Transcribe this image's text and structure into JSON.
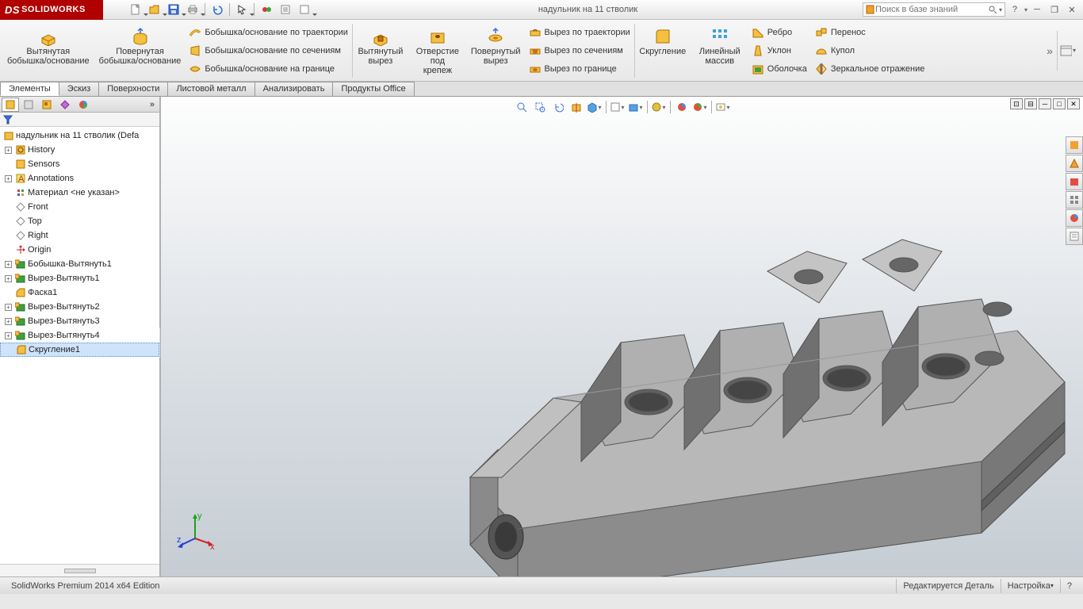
{
  "app": {
    "name": "SOLIDWORKS",
    "ds": "DS"
  },
  "doc_title": "надульник  на 11 стволик",
  "search": {
    "placeholder": "Поиск в базе знаний"
  },
  "ribbon": {
    "extrude_boss": "Вытянутая\nбобышка/основание",
    "revolve_boss": "Повернутая\nбобышка/основание",
    "swept_boss": "Бобышка/основание по траектории",
    "lofted_boss": "Бобышка/основание по сечениям",
    "boundary_boss": "Бобышка/основание на границе",
    "extrude_cut": "Вытянутый\nвырез",
    "hole_wizard": "Отверстие\nпод\nкрепеж",
    "revolve_cut": "Повернутый\nвырез",
    "swept_cut": "Вырез по траектории",
    "lofted_cut": "Вырез по сечениям",
    "boundary_cut": "Вырез по границе",
    "fillet": "Скругление",
    "linpattern": "Линейный\nмассив",
    "rib": "Ребро",
    "draft": "Уклон",
    "shell": "Оболочка",
    "move": "Перенос",
    "dome": "Купол",
    "mirror": "Зеркальное отражение"
  },
  "cmdtabs": [
    "Элементы",
    "Эскиз",
    "Поверхности",
    "Листовой металл",
    "Анализировать",
    "Продукты Office"
  ],
  "tree": {
    "root": "надульник  на 11 стволик  (Defa",
    "items": [
      {
        "exp": "+",
        "icon": "history",
        "label": "History"
      },
      {
        "exp": "",
        "icon": "sensors",
        "label": "Sensors"
      },
      {
        "exp": "+",
        "icon": "annot",
        "label": "Annotations"
      },
      {
        "exp": "",
        "icon": "material",
        "label": "Материал <не указан>"
      },
      {
        "exp": "",
        "icon": "plane",
        "label": "Front"
      },
      {
        "exp": "",
        "icon": "plane",
        "label": "Top"
      },
      {
        "exp": "",
        "icon": "plane",
        "label": "Right"
      },
      {
        "exp": "",
        "icon": "origin",
        "label": "Origin"
      },
      {
        "exp": "+",
        "icon": "feat",
        "label": "Бобышка-Вытянуть1"
      },
      {
        "exp": "+",
        "icon": "feat",
        "label": "Вырез-Вытянуть1"
      },
      {
        "exp": "",
        "icon": "chamf",
        "label": "Фаска1"
      },
      {
        "exp": "+",
        "icon": "feat",
        "label": "Вырез-Вытянуть2"
      },
      {
        "exp": "+",
        "icon": "feat",
        "label": "Вырез-Вытянуть3"
      },
      {
        "exp": "+",
        "icon": "feat",
        "label": "Вырез-Вытянуть4"
      },
      {
        "exp": "",
        "icon": "fillet",
        "label": "Скругление1",
        "sel": true
      }
    ]
  },
  "status": {
    "left": "SolidWorks Premium 2014 x64 Edition",
    "mode": "Редактируется Деталь",
    "custom": "Настройка"
  },
  "triad": {
    "x": "x",
    "y": "y",
    "z": "z"
  }
}
